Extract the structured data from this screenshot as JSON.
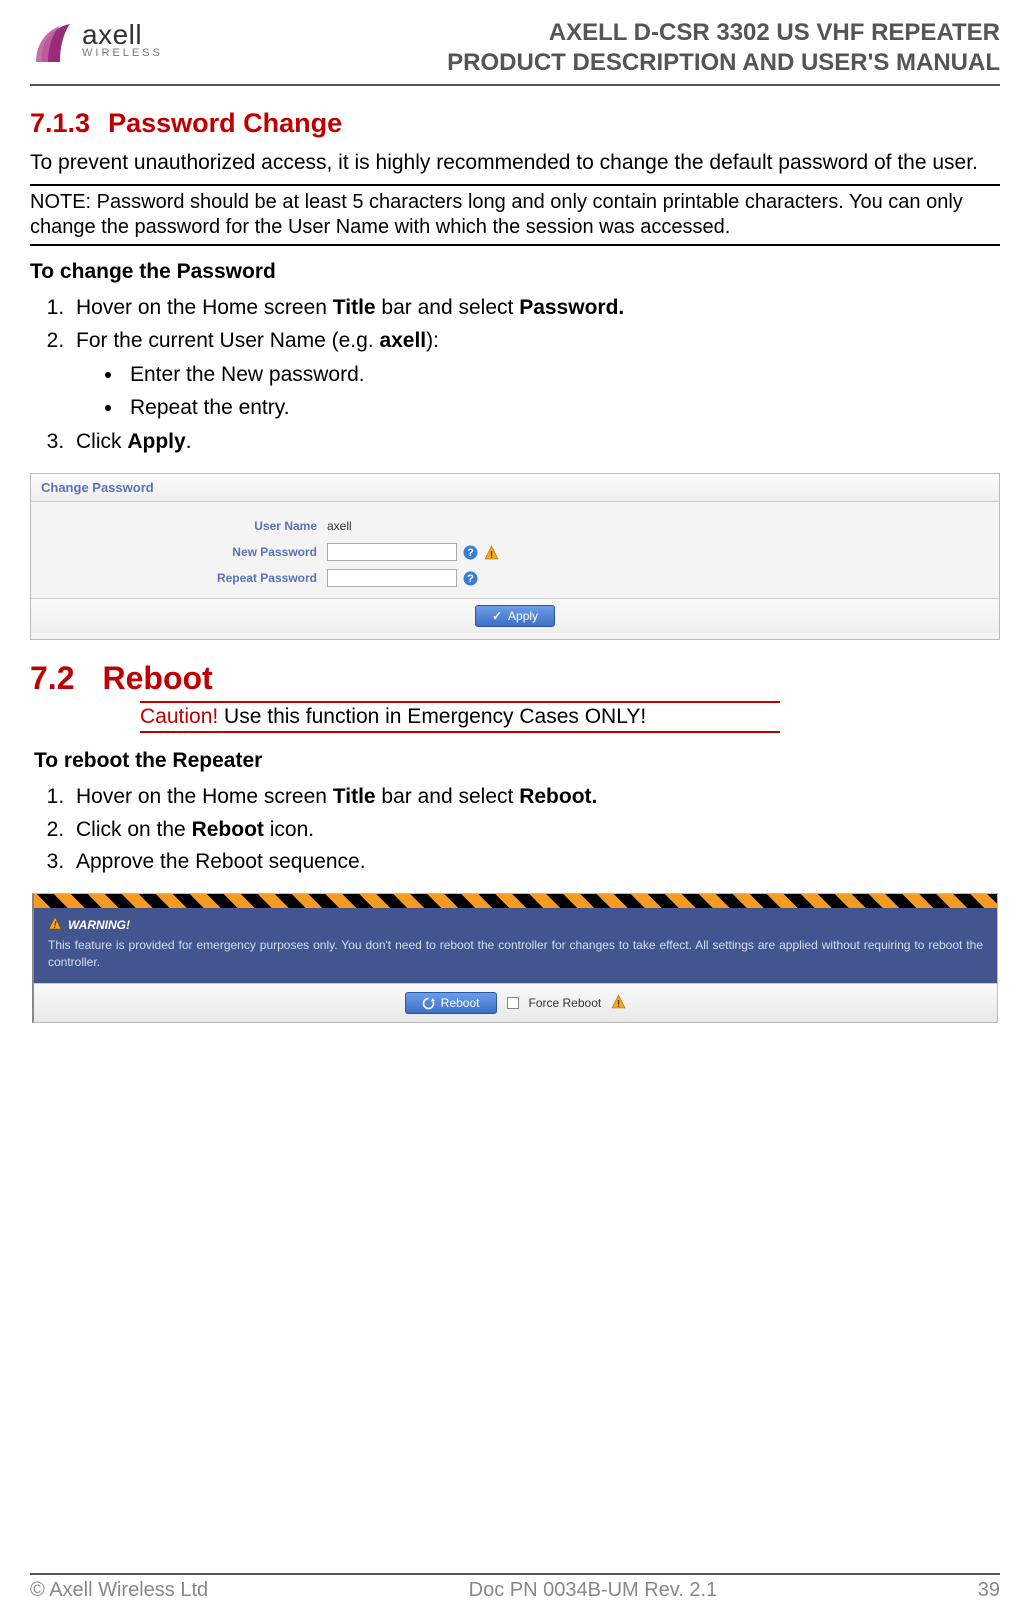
{
  "header": {
    "brand": "axell",
    "brand_sub": "WIRELESS",
    "title_line1": "AXELL D-CSR 3302 US VHF REPEATER",
    "title_line2": "PRODUCT DESCRIPTION AND USER'S MANUAL"
  },
  "sec713": {
    "num": "7.1.3",
    "title": "Password Change",
    "intro": "To prevent unauthorized access, it is highly recommended to change the default password of the user.",
    "note": "NOTE: Password should be at least 5 characters long and only contain printable characters. You can only change the password for the User Name with which the session was accessed.",
    "subhead": "To change the Password",
    "step1_a": "Hover on the Home screen ",
    "step1_b": "Title",
    "step1_c": " bar and select ",
    "step1_d": "Password.",
    "step2_a": "For the current User Name (e.g. ",
    "step2_b": "axell",
    "step2_c": "):",
    "bullet1": "Enter the New password.",
    "bullet2": "Repeat the entry.",
    "step3_a": "Click ",
    "step3_b": "Apply",
    "step3_c": "."
  },
  "panel1": {
    "title": "Change Password",
    "label_user": "User Name",
    "value_user": "axell",
    "label_new": "New Password",
    "label_repeat": "Repeat Password",
    "apply": "Apply"
  },
  "sec72": {
    "num": "7.2",
    "title": "Reboot",
    "caution_label": "Caution!",
    "caution_text": " Use this function in Emergency Cases ONLY!",
    "subhead": "To reboot the Repeater",
    "step1_a": "Hover on the Home screen ",
    "step1_b": "Title",
    "step1_c": " bar and select ",
    "step1_d": "Reboot.",
    "step2_a": "Click on the ",
    "step2_b": "Reboot",
    "step2_c": " icon.",
    "step3": "Approve the Reboot sequence."
  },
  "panel2": {
    "warn_head": "WARNING!",
    "warn_body": "This feature is provided for emergency purposes only. You don't need to reboot the controller for changes to take effect. All settings are applied without requiring to reboot the controller.",
    "reboot": "Reboot",
    "force": "Force Reboot"
  },
  "footer": {
    "left": "© Axell Wireless Ltd",
    "center": "Doc PN 0034B-UM Rev. 2.1",
    "right": "39"
  }
}
